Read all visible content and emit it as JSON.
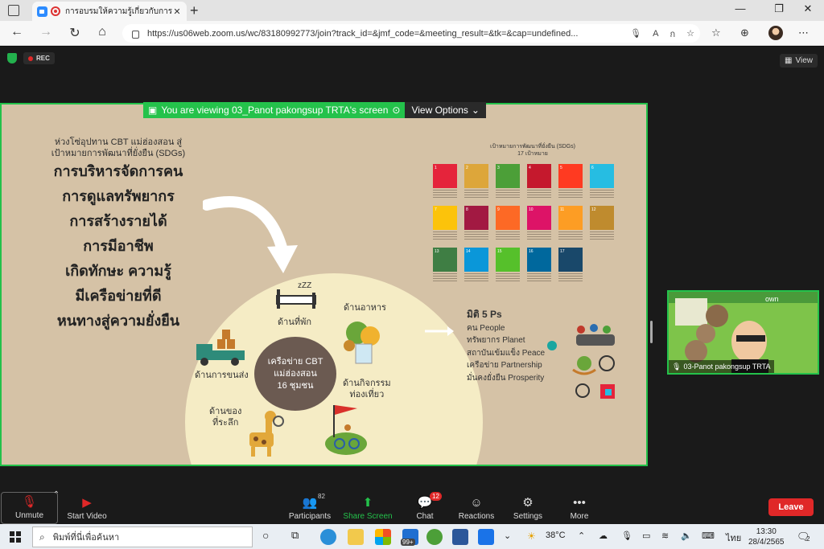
{
  "browser": {
    "tab_title": "การอบรมให้ความรู้เกี่ยวกับการท่อ",
    "url": "https://us06web.zoom.us/wc/83180992773/join?track_id=&jmf_code=&meeting_result=&tk=&cap=undefined..."
  },
  "meeting": {
    "rec_label": "REC",
    "view_label": "View",
    "viewing_text": "You are viewing 03_Panot pakongsup TRTA's screen",
    "view_options_label": "View Options",
    "participant_name": "03-Panot pakongsup TRTA"
  },
  "slide": {
    "intro_line1": "ห่วงโซ่อุปทาน CBT แม่ฮ่องสอน สู่",
    "intro_line2": "เป้าหมายการพัฒนาที่ยั่งยืน (SDGs)",
    "big_lines": [
      "การบริหารจัดการคน",
      "การดูแลทรัพยากร",
      "การสร้างรายได้",
      "การมีอาชีพ",
      "เกิดทักษะ ความรู้",
      "มีเครือข่ายที่ดี",
      "หนทางสู่ความยั่งยืน"
    ],
    "sdg_title_line1": "เป้าหมายการพัฒนาที่ยั่งยืน (SDGs)",
    "sdg_title_line2": "17 เป้าหมาย",
    "sdg_colors": [
      "#e5243b",
      "#dda63a",
      "#4c9f38",
      "#c5192d",
      "#ff3a21",
      "#26bde2",
      "#fcc30b",
      "#a21942",
      "#fd6925",
      "#dd1367",
      "#fd9d24",
      "#bf8b2e",
      "#3f7e44",
      "#0a97d9",
      "#56c02b",
      "#00689d",
      "#19486a"
    ],
    "sdg_numbers": [
      "1",
      "2",
      "3",
      "4",
      "5",
      "6",
      "7",
      "8",
      "9",
      "10",
      "11",
      "12",
      "13",
      "14",
      "15",
      "16",
      "17"
    ],
    "cbt_line1": "เครือข่าย CBT",
    "cbt_line2": "แม่ฮ่องสอน",
    "cbt_line3": "16 ชุมชน",
    "label_lodging": "ด้านที่พัก",
    "label_food": "ด้านอาหาร",
    "label_transport": "ด้านการขนส่ง",
    "label_activity_1": "ด้านกิจกรรม",
    "label_activity_2": "ท่องเที่ยว",
    "label_souvenir_1": "ด้านของ",
    "label_souvenir_2": "ที่ระลึก",
    "five_p_title": "มิติ 5 Ps",
    "five_p_items": [
      "คน People",
      "ทรัพยากร Planet",
      "สถาบันเข้มแข็ง Peace",
      "เครือข่าย Partnership",
      "มั่นคงยั่งยืน Prosperity"
    ]
  },
  "toolbar": {
    "unmute": "Unmute",
    "start_video": "Start Video",
    "participants": "Participants",
    "participants_count": "82",
    "share_screen": "Share Screen",
    "chat": "Chat",
    "chat_count": "12",
    "reactions": "Reactions",
    "settings": "Settings",
    "more": "More",
    "leave": "Leave"
  },
  "taskbar": {
    "search_placeholder": "พิมพ์ที่นี่เพื่อค้นหา",
    "badge_99": "99+",
    "temperature": "38°C",
    "language": "ไทย",
    "time": "13:30",
    "date": "28/4/2565",
    "notification_count": "2"
  }
}
